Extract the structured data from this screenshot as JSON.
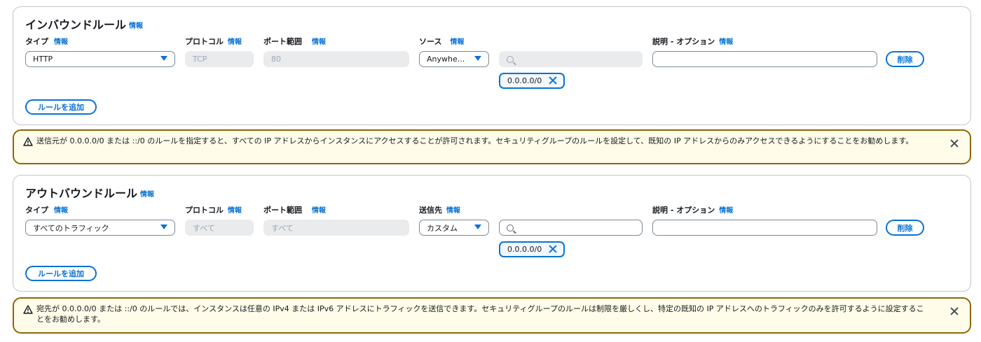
{
  "inbound": {
    "title": "インバウンドルール",
    "title_info": "情報",
    "labels": {
      "type": "タイプ",
      "type_info": "情報",
      "protocol": "プロトコル",
      "protocol_info": "情報",
      "port_range": "ポート範囲",
      "port_range_info": "情報",
      "source": "ソース",
      "source_info": "情報",
      "description": "説明 - オプション",
      "description_info": "情報"
    },
    "rule": {
      "type_value": "HTTP",
      "protocol_value": "TCP",
      "port_value": "80",
      "source_value": "Anywhe...",
      "search_value": "",
      "description_value": "",
      "token": "0.0.0.0/0",
      "delete_label": "削除"
    },
    "add_rule_label": "ルールを追加"
  },
  "inbound_alert": {
    "text": "送信元が 0.0.0.0/0 または ::/0 のルールを指定すると、すべての IP アドレスからインスタンスにアクセスすることが許可されます。セキュリティグループのルールを設定して、既知の IP アドレスからのみアクセスできるようにすることをお勧めします。"
  },
  "outbound": {
    "title": "アウトバウンドルール",
    "title_info": "情報",
    "labels": {
      "type": "タイプ",
      "type_info": "情報",
      "protocol": "プロトコル",
      "protocol_info": "情報",
      "port_range": "ポート範囲",
      "port_range_info": "情報",
      "destination": "送信先",
      "destination_info": "情報",
      "description": "説明 - オプション",
      "description_info": "情報"
    },
    "rule": {
      "type_value": "すべてのトラフィック",
      "protocol_value": "すべて",
      "port_value": "すべて",
      "destination_value": "カスタム",
      "search_value": "",
      "description_value": "",
      "token": "0.0.0.0/0",
      "delete_label": "削除"
    },
    "add_rule_label": "ルールを追加"
  },
  "outbound_alert": {
    "text": "宛先が 0.0.0.0/0 または ::/0 のルールでは、インスタンスは任意の IPv4 または IPv6 アドレスにトラフィックを送信できます。セキュリティグループのルールは制限を厳しくし、特定の既知の IP アドレスへのトラフィックのみを許可するように設定することをお勧めします。"
  },
  "colors": {
    "link": "#0972d3",
    "warning_border": "#8d6605",
    "warning_bg": "#fffce9"
  }
}
